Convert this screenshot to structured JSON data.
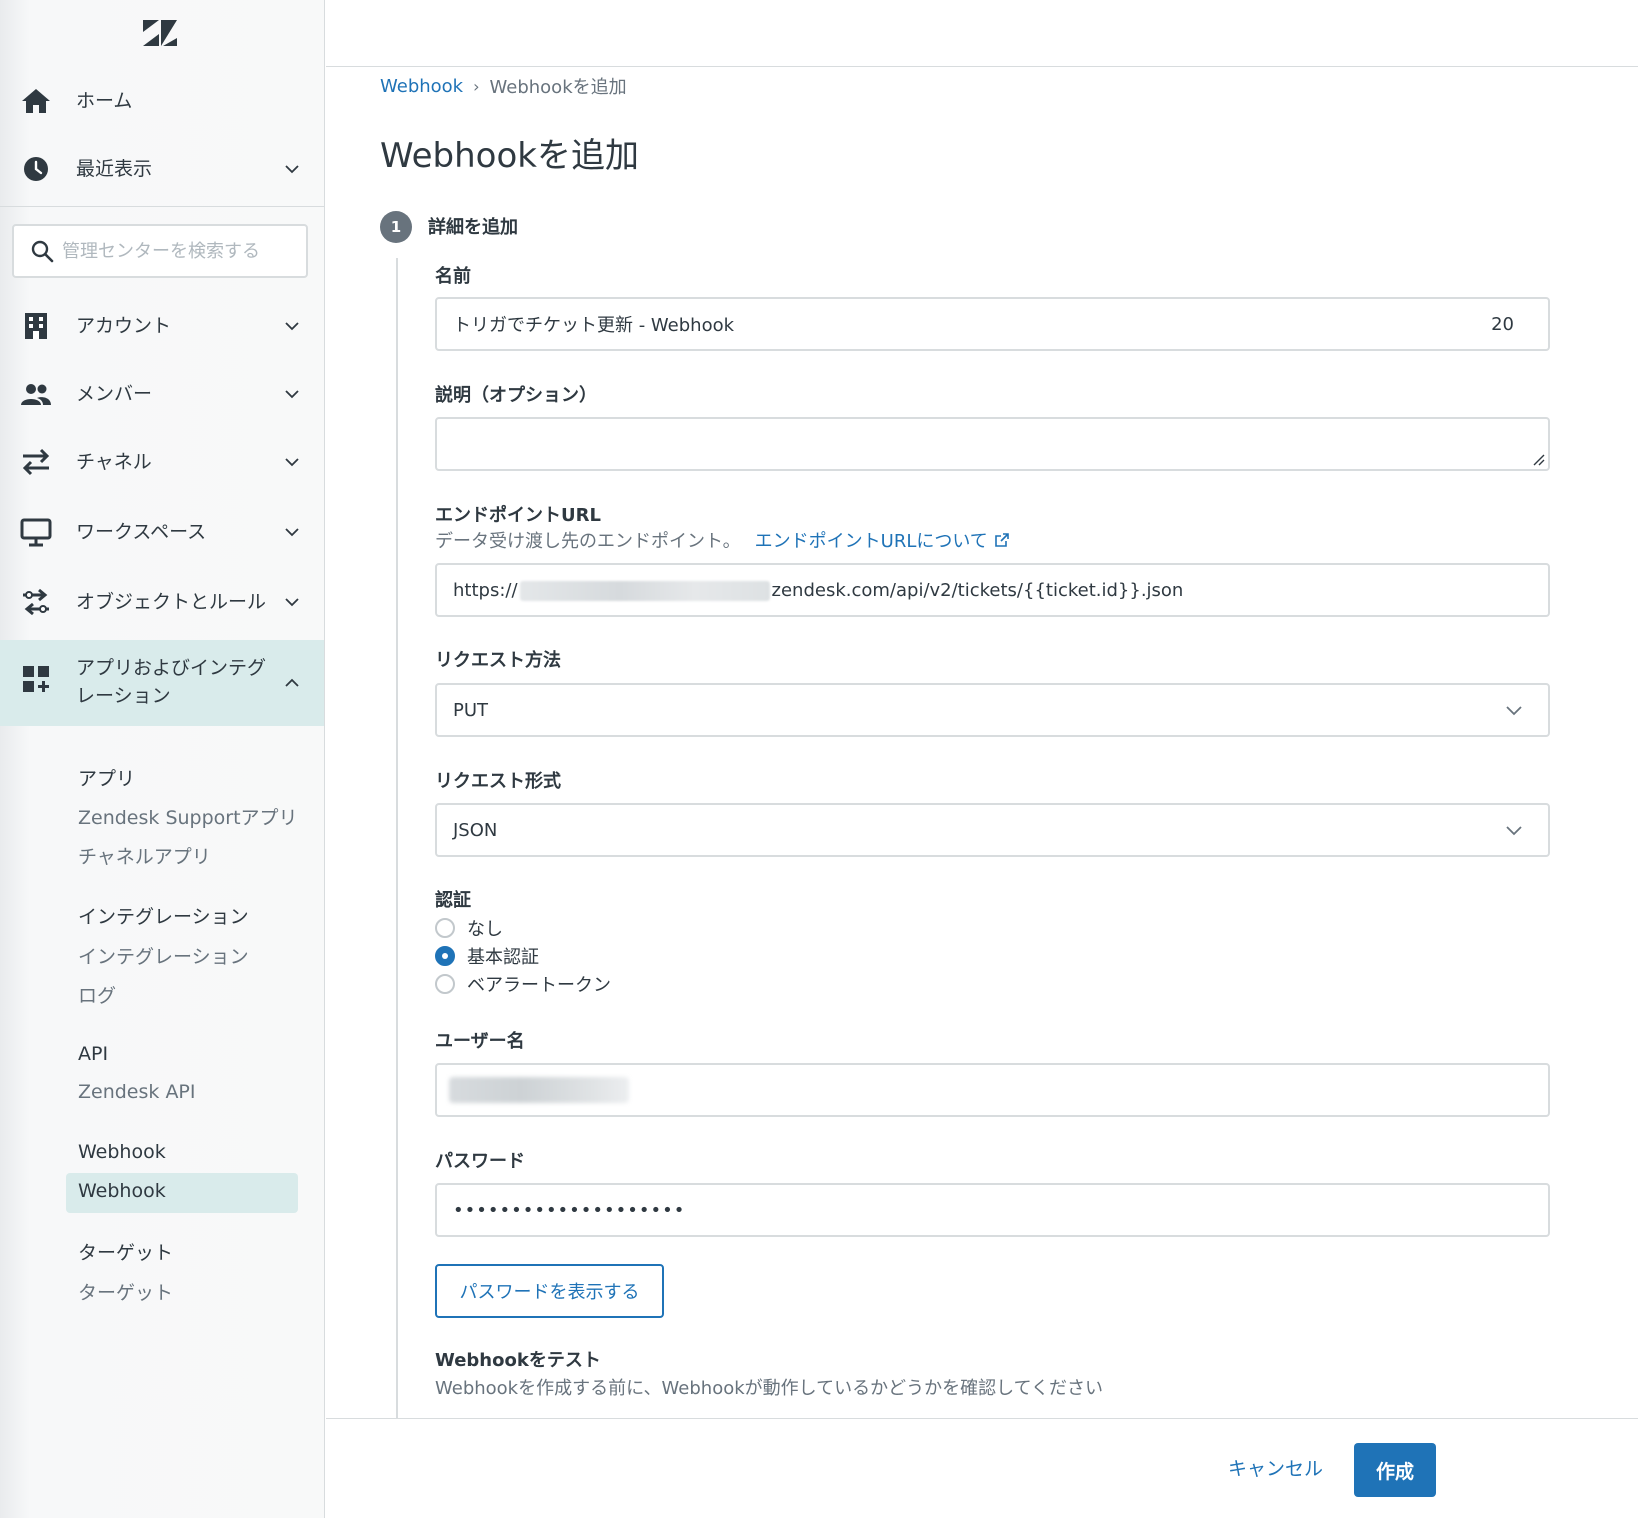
{
  "sidebar": {
    "nav": [
      {
        "label": "ホーム",
        "icon": "home-icon"
      },
      {
        "label": "最近表示",
        "icon": "clock-icon"
      },
      {
        "label": "アカウント",
        "icon": "building-icon"
      },
      {
        "label": "メンバー",
        "icon": "people-icon"
      },
      {
        "label": "チャネル",
        "icon": "arrows-icon"
      },
      {
        "label": "ワークスペース",
        "icon": "monitor-icon"
      },
      {
        "label": "オブジェクトとルール",
        "icon": "rules-icon"
      },
      {
        "label": "アプリおよびインテグレーション",
        "icon": "apps-icon"
      }
    ],
    "search_placeholder": "管理センターを検索する",
    "sub": {
      "apps_head": "アプリ",
      "apps_links": [
        "Zendesk Supportアプリ",
        "チャネルアプリ"
      ],
      "integrations_head": "インテグレーション",
      "integrations_links": [
        "インテグレーション",
        "ログ"
      ],
      "api_head": "API",
      "api_links": [
        "Zendesk API"
      ],
      "webhook_head": "Webhook",
      "webhook_selected": "Webhook",
      "targets_head": "ターゲット",
      "targets_links": [
        "ターゲット"
      ]
    }
  },
  "breadcrumb": {
    "parent": "Webhook",
    "separator": "›",
    "current": "Webhookを追加"
  },
  "page_title": "Webhookを追加",
  "step": {
    "number": "1",
    "title": "詳細を追加"
  },
  "form": {
    "name_label": "名前",
    "name_value": "トリガでチケット更新 - Webhook",
    "name_counter": "20",
    "desc_label": "説明（オプション）",
    "desc_value": "",
    "endpoint_label": "エンドポイントURL",
    "endpoint_hint": "データ受け渡し先のエンドポイント。",
    "endpoint_link": "エンドポイントURLについて",
    "endpoint_prefix": "https://",
    "endpoint_suffix": "zendesk.com/api/v2/tickets/{{ticket.id}}.json",
    "method_label": "リクエスト方法",
    "method_value": "PUT",
    "format_label": "リクエスト形式",
    "format_value": "JSON",
    "auth_label": "認証",
    "auth_options": [
      "なし",
      "基本認証",
      "ベアラートークン"
    ],
    "auth_selected": 1,
    "username_label": "ユーザー名",
    "password_label": "パスワード",
    "password_value": "••••••••••••••••••••",
    "show_password_btn": "パスワードを表示する",
    "test_label": "Webhookをテスト",
    "test_hint": "Webhookを作成する前に、Webhookが動作しているかどうかを確認してください"
  },
  "footer": {
    "cancel": "キャンセル",
    "create": "作成"
  },
  "colors": {
    "accent": "#1f73b7",
    "active_bg": "#d9ebeb",
    "text": "#2f3941",
    "muted": "#68737d",
    "border": "#d8dcde"
  }
}
